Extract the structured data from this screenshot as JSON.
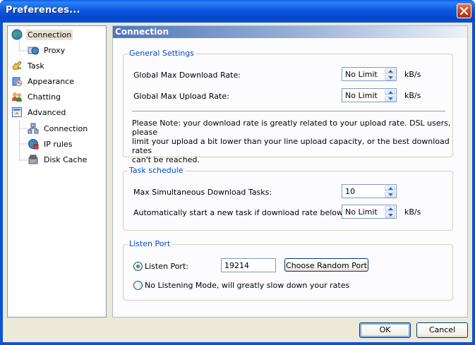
{
  "window": {
    "title": "Preferences..."
  },
  "tree": {
    "items": [
      {
        "label": "Connection",
        "icon": "globe-icon",
        "selected": true
      },
      {
        "label": "Proxy",
        "icon": "proxy-globe-icon"
      },
      {
        "label": "Task",
        "icon": "task-hand-icon"
      },
      {
        "label": "Appearance",
        "icon": "appearance-palette-icon"
      },
      {
        "label": "Chatting",
        "icon": "chat-users-icon"
      },
      {
        "label": "Advanced",
        "icon": "advanced-panel-icon"
      },
      {
        "label": "Connection",
        "icon": "network-icon"
      },
      {
        "label": "IP rules",
        "icon": "ip-globe-icon"
      },
      {
        "label": "Disk Cache",
        "icon": "disk-icon"
      }
    ]
  },
  "panel": {
    "title": "Connection"
  },
  "general": {
    "title": "General Settings",
    "download_label": "Global Max Download Rate:",
    "download_value": "No Limit",
    "download_unit": "kB/s",
    "upload_label": "Global Max Upload Rate:",
    "upload_value": "No Limit",
    "upload_unit": "kB/s",
    "note_lines": [
      "Please Note: your download rate is greatly related to your upload rate. DSL users, please",
      "limit your upload a bit lower than your line upload capacity, or the best download rates",
      "can't be reached."
    ]
  },
  "schedule": {
    "title": "Task schedule",
    "max_tasks_label": "Max Simultaneous Download Tasks:",
    "max_tasks_value": "10",
    "auto_label": "Automatically start a new task if download rate below:",
    "auto_value": "No Limit",
    "auto_unit": "kB/s"
  },
  "listen": {
    "title": "Listen Port",
    "port_radio_label": "Listen Port:",
    "port_value": "19214",
    "random_button": "Choose Random Port",
    "no_listen_label": "No Listening Mode, will greatly slow down your rates",
    "selected_option": "Listen Port"
  },
  "footer": {
    "ok_label": "OK",
    "cancel_label": "Cancel"
  },
  "colors": {
    "titlebar": "#0a5fe8",
    "group_title": "#0046d5",
    "panel_header": "#4e76b8",
    "dialog_face": "#ece9d8"
  }
}
